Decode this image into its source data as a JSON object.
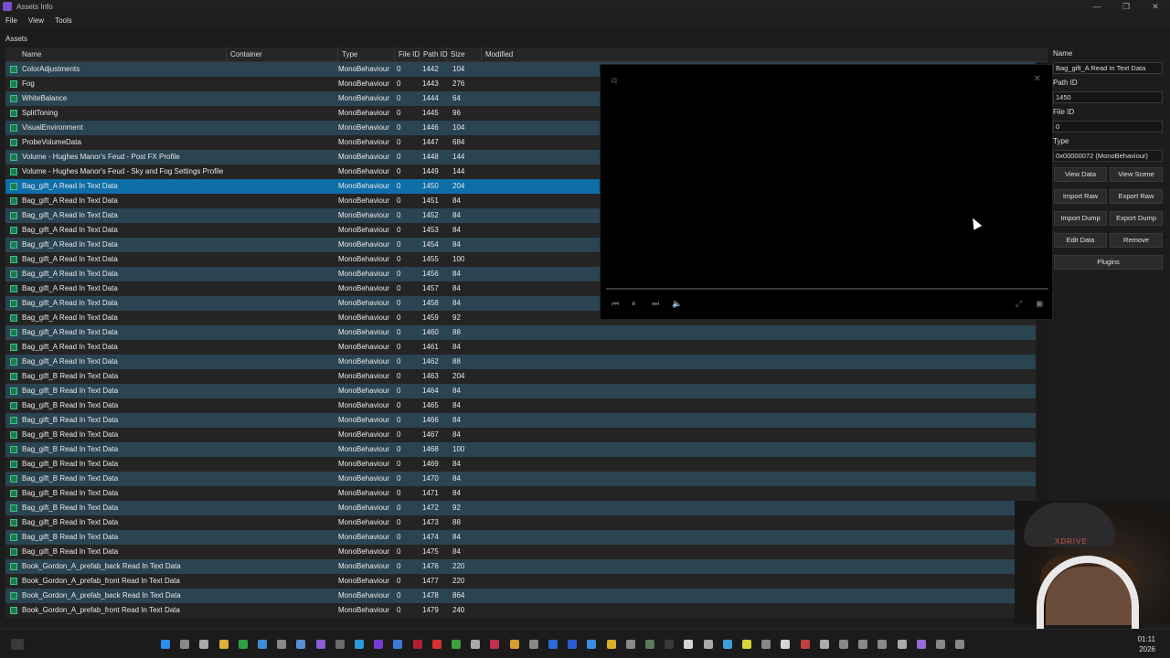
{
  "window": {
    "title": "Assets Info",
    "controls": [
      "—",
      "❐",
      "✕"
    ]
  },
  "menu": [
    "File",
    "View",
    "Tools"
  ],
  "assets_label": "Assets",
  "columns": [
    "Name",
    "Container",
    "Type",
    "File ID",
    "Path ID",
    "Size",
    "Modified"
  ],
  "rows": [
    {
      "name": "ColorAdjustments",
      "type": "MonoBehaviour",
      "file_id": "0",
      "path_id": "1442",
      "size": "104"
    },
    {
      "name": "Fog",
      "type": "MonoBehaviour",
      "file_id": "0",
      "path_id": "1443",
      "size": "276"
    },
    {
      "name": "WhiteBalance",
      "type": "MonoBehaviour",
      "file_id": "0",
      "path_id": "1444",
      "size": "64"
    },
    {
      "name": "SplitToning",
      "type": "MonoBehaviour",
      "file_id": "0",
      "path_id": "1445",
      "size": "96"
    },
    {
      "name": "VisualEnvironment",
      "type": "MonoBehaviour",
      "file_id": "0",
      "path_id": "1446",
      "size": "104"
    },
    {
      "name": "ProbeVolumeData",
      "type": "MonoBehaviour",
      "file_id": "0",
      "path_id": "1447",
      "size": "684"
    },
    {
      "name": "Volume - Hughes Manor's Feud - Post FX Profile",
      "type": "MonoBehaviour",
      "file_id": "0",
      "path_id": "1448",
      "size": "144"
    },
    {
      "name": "Volume - Hughes Manor's Feud - Sky and Fog Settings Profile",
      "type": "MonoBehaviour",
      "file_id": "0",
      "path_id": "1449",
      "size": "144"
    },
    {
      "name": "Bag_gift_A Read In Text Data",
      "type": "MonoBehaviour",
      "file_id": "0",
      "path_id": "1450",
      "size": "204",
      "selected": true
    },
    {
      "name": "Bag_gift_A Read In Text Data",
      "type": "MonoBehaviour",
      "file_id": "0",
      "path_id": "1451",
      "size": "84"
    },
    {
      "name": "Bag_gift_A Read In Text Data",
      "type": "MonoBehaviour",
      "file_id": "0",
      "path_id": "1452",
      "size": "84"
    },
    {
      "name": "Bag_gift_A Read In Text Data",
      "type": "MonoBehaviour",
      "file_id": "0",
      "path_id": "1453",
      "size": "84"
    },
    {
      "name": "Bag_gift_A Read In Text Data",
      "type": "MonoBehaviour",
      "file_id": "0",
      "path_id": "1454",
      "size": "84"
    },
    {
      "name": "Bag_gift_A Read In Text Data",
      "type": "MonoBehaviour",
      "file_id": "0",
      "path_id": "1455",
      "size": "100"
    },
    {
      "name": "Bag_gift_A Read In Text Data",
      "type": "MonoBehaviour",
      "file_id": "0",
      "path_id": "1456",
      "size": "84"
    },
    {
      "name": "Bag_gift_A Read In Text Data",
      "type": "MonoBehaviour",
      "file_id": "0",
      "path_id": "1457",
      "size": "84"
    },
    {
      "name": "Bag_gift_A Read In Text Data",
      "type": "MonoBehaviour",
      "file_id": "0",
      "path_id": "1458",
      "size": "84"
    },
    {
      "name": "Bag_gift_A Read In Text Data",
      "type": "MonoBehaviour",
      "file_id": "0",
      "path_id": "1459",
      "size": "92"
    },
    {
      "name": "Bag_gift_A Read In Text Data",
      "type": "MonoBehaviour",
      "file_id": "0",
      "path_id": "1460",
      "size": "88"
    },
    {
      "name": "Bag_gift_A Read In Text Data",
      "type": "MonoBehaviour",
      "file_id": "0",
      "path_id": "1461",
      "size": "84"
    },
    {
      "name": "Bag_gift_A Read In Text Data",
      "type": "MonoBehaviour",
      "file_id": "0",
      "path_id": "1462",
      "size": "88"
    },
    {
      "name": "Bag_gift_B Read In Text Data",
      "type": "MonoBehaviour",
      "file_id": "0",
      "path_id": "1463",
      "size": "204"
    },
    {
      "name": "Bag_gift_B Read In Text Data",
      "type": "MonoBehaviour",
      "file_id": "0",
      "path_id": "1464",
      "size": "84"
    },
    {
      "name": "Bag_gift_B Read In Text Data",
      "type": "MonoBehaviour",
      "file_id": "0",
      "path_id": "1465",
      "size": "84"
    },
    {
      "name": "Bag_gift_B Read In Text Data",
      "type": "MonoBehaviour",
      "file_id": "0",
      "path_id": "1466",
      "size": "84"
    },
    {
      "name": "Bag_gift_B Read In Text Data",
      "type": "MonoBehaviour",
      "file_id": "0",
      "path_id": "1467",
      "size": "84"
    },
    {
      "name": "Bag_gift_B Read In Text Data",
      "type": "MonoBehaviour",
      "file_id": "0",
      "path_id": "1468",
      "size": "100"
    },
    {
      "name": "Bag_gift_B Read In Text Data",
      "type": "MonoBehaviour",
      "file_id": "0",
      "path_id": "1469",
      "size": "84"
    },
    {
      "name": "Bag_gift_B Read In Text Data",
      "type": "MonoBehaviour",
      "file_id": "0",
      "path_id": "1470",
      "size": "84"
    },
    {
      "name": "Bag_gift_B Read In Text Data",
      "type": "MonoBehaviour",
      "file_id": "0",
      "path_id": "1471",
      "size": "84"
    },
    {
      "name": "Bag_gift_B Read In Text Data",
      "type": "MonoBehaviour",
      "file_id": "0",
      "path_id": "1472",
      "size": "92"
    },
    {
      "name": "Bag_gift_B Read In Text Data",
      "type": "MonoBehaviour",
      "file_id": "0",
      "path_id": "1473",
      "size": "88"
    },
    {
      "name": "Bag_gift_B Read In Text Data",
      "type": "MonoBehaviour",
      "file_id": "0",
      "path_id": "1474",
      "size": "84"
    },
    {
      "name": "Bag_gift_B Read In Text Data",
      "type": "MonoBehaviour",
      "file_id": "0",
      "path_id": "1475",
      "size": "84"
    },
    {
      "name": "Book_Gordon_A_prefab_back Read In Text Data",
      "type": "MonoBehaviour",
      "file_id": "0",
      "path_id": "1476",
      "size": "220"
    },
    {
      "name": "Book_Gordon_A_prefab_front Read In Text Data",
      "type": "MonoBehaviour",
      "file_id": "0",
      "path_id": "1477",
      "size": "220"
    },
    {
      "name": "Book_Gordon_A_prefab_back Read In Text Data",
      "type": "MonoBehaviour",
      "file_id": "0",
      "path_id": "1478",
      "size": "864"
    },
    {
      "name": "Book_Gordon_A_prefab_front Read In Text Data",
      "type": "MonoBehaviour",
      "file_id": "0",
      "path_id": "1479",
      "size": "240"
    }
  ],
  "panel": {
    "name_label": "Name",
    "name_value": "Bag_gift_A Read In Text Data",
    "path_id_label": "Path ID",
    "path_id_value": "1450",
    "file_id_label": "File ID",
    "file_id_value": "0",
    "type_label": "Type",
    "type_value": "0x00000072 (MonoBehaviour)",
    "buttons": {
      "view_data": "View Data",
      "view_scene": "View Scene",
      "import_raw": "Import Raw",
      "export_raw": "Export Raw",
      "import_dump": "Import Dump",
      "export_dump": "Export Dump",
      "edit_data": "Edit Data",
      "remove": "Remove",
      "plugins": "Plugins"
    }
  },
  "video": {
    "controls": [
      "⏮",
      "⏸",
      "⏭",
      "🔈"
    ],
    "right_controls": [
      "⤢",
      "▣"
    ],
    "progress": 0
  },
  "webcam": {
    "hat_text": "XDRIVE"
  },
  "taskbar": {
    "time": "01:11",
    "date": "2026"
  },
  "colors": {
    "row_odd": "#2a4452",
    "row_even": "#242424",
    "row_selected": "#0d6ea8",
    "icon_green": "#3ec48a"
  }
}
